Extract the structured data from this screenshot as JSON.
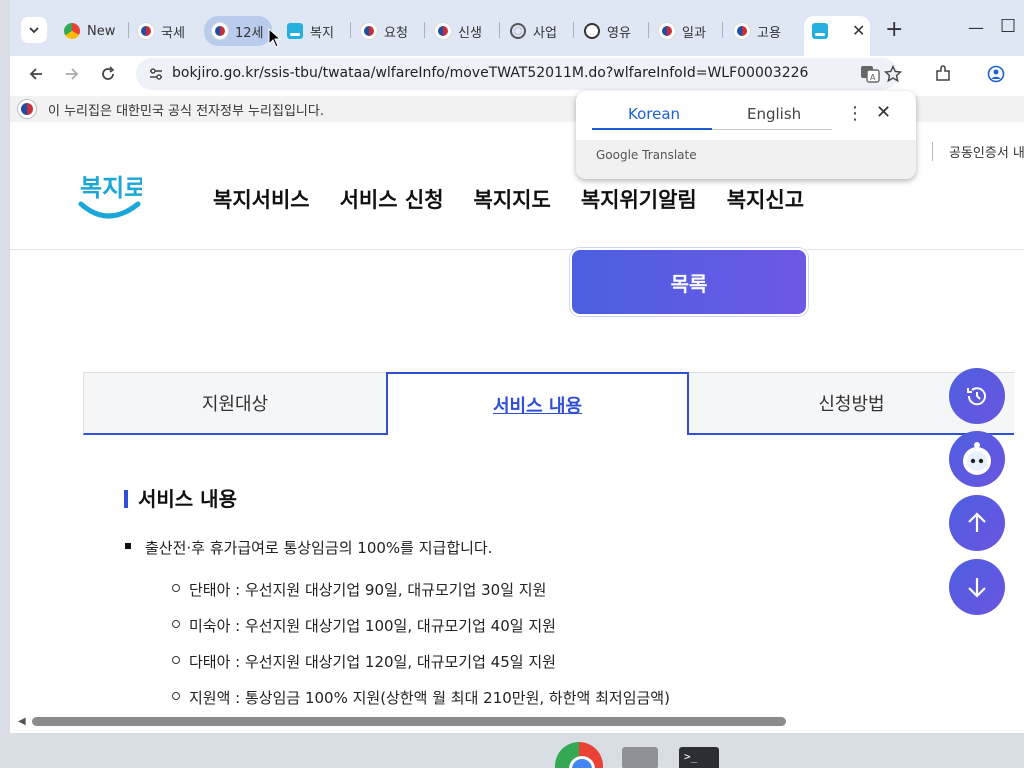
{
  "browser": {
    "tabs": [
      {
        "label": "New",
        "icon": "chrome-icon"
      },
      {
        "label": "국세",
        "icon": "gov-emblem-icon"
      },
      {
        "label": "12세",
        "icon": "gov-emblem-icon"
      },
      {
        "label": "복지",
        "icon": "bokjiro-icon"
      },
      {
        "label": "요청",
        "icon": "gov-emblem-icon"
      },
      {
        "label": "신생",
        "icon": "gov-emblem-icon"
      },
      {
        "label": "사업",
        "icon": "globe-icon"
      },
      {
        "label": "영유",
        "icon": "face-icon"
      },
      {
        "label": "일과",
        "icon": "gov-emblem-icon"
      },
      {
        "label": "고용",
        "icon": "gov-emblem-icon"
      },
      {
        "label": "",
        "icon": "bokjiro-icon"
      }
    ],
    "url": "bokjiro.go.kr/ssis-tbu/twataa/wlfareInfo/moveTWAT52011M.do?wlfareInfoId=WLF00003226"
  },
  "translate_popup": {
    "lang_source": "Korean",
    "lang_target": "English",
    "footer": "Google Translate"
  },
  "gov_banner": {
    "text": "이 누리집은 대한민국 공식 전자정부 누리집입니다."
  },
  "site": {
    "logo_text": "복지로",
    "nav": [
      "복지서비스",
      "서비스 신청",
      "복지지도",
      "복지위기알림",
      "복지신고"
    ],
    "cert_link": "공동인증서 내"
  },
  "main": {
    "list_button": "목록",
    "tabs": [
      {
        "label": "지원대상"
      },
      {
        "label": "서비스 내용"
      },
      {
        "label": "신청방법"
      }
    ],
    "section_title": "서비스 내용",
    "bullet": "출산전·후 휴가급여로 통상임금의 100%를 지급합니다.",
    "sub_items": [
      "단태아 : 우선지원 대상기업 90일, 대규모기업 30일 지원",
      "미숙아 : 우선지원 대상기업 100일, 대규모기업 40일 지원",
      "다태아 : 우선지원 대상기업 120일, 대규모기업 45일 지원",
      "지원액 : 통상임금 100% 지원(상한액 월 최대 210만원, 하한액 최저임금액)"
    ]
  },
  "colors": {
    "accent": "#2f4fd8",
    "button_gradient_start": "#4b5fe0",
    "button_gradient_end": "#6d58e6"
  }
}
